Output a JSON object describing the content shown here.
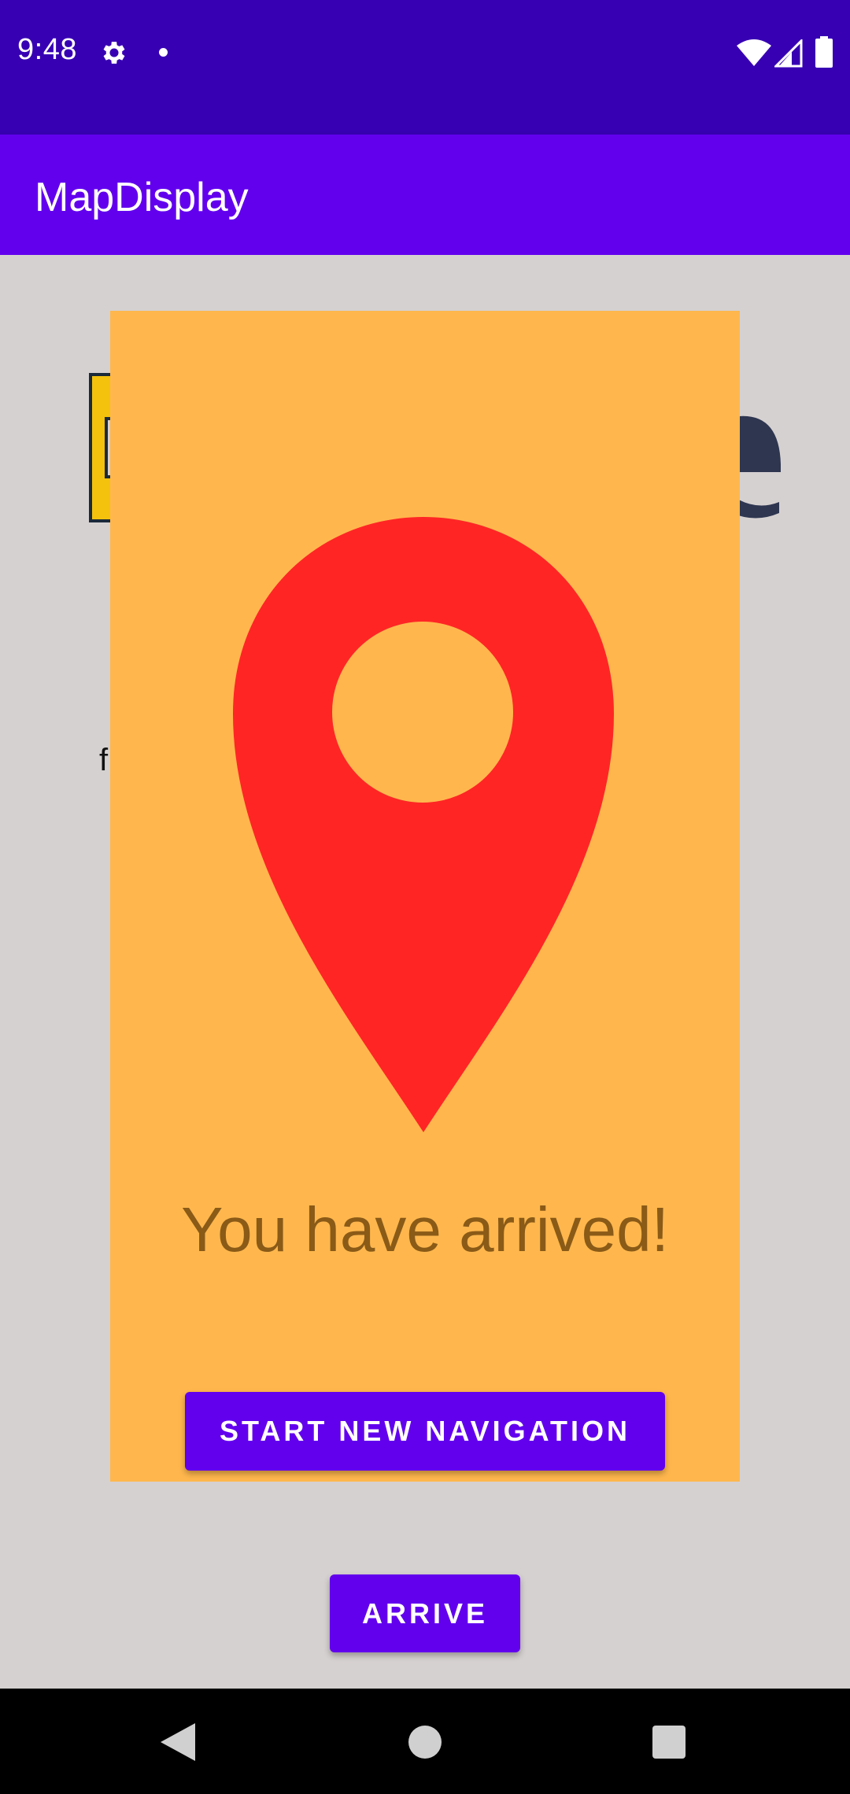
{
  "status_bar": {
    "time": "9:48",
    "icons": [
      "gear-icon",
      "notification-dot",
      "wifi-icon",
      "signal-icon",
      "battery-icon"
    ]
  },
  "app_bar": {
    "title": "MapDisplay"
  },
  "background": {
    "text_fragment": "f"
  },
  "dialog": {
    "icon": "location-pin-icon",
    "message": "You have arrived!",
    "button_label": "START NEW NAVIGATION"
  },
  "main": {
    "arrive_button_label": "ARRIVE"
  },
  "colors": {
    "status_bar": "#3700b3",
    "app_bar": "#6200ee",
    "dialog_bg": "#ffb74d",
    "pin": "#ff2525",
    "message_text": "#8a5a17",
    "button": "#6200ee",
    "page_bg": "#d6d1d1"
  },
  "nav_bar": {
    "icons": [
      "back-icon",
      "home-icon",
      "recents-icon"
    ]
  }
}
